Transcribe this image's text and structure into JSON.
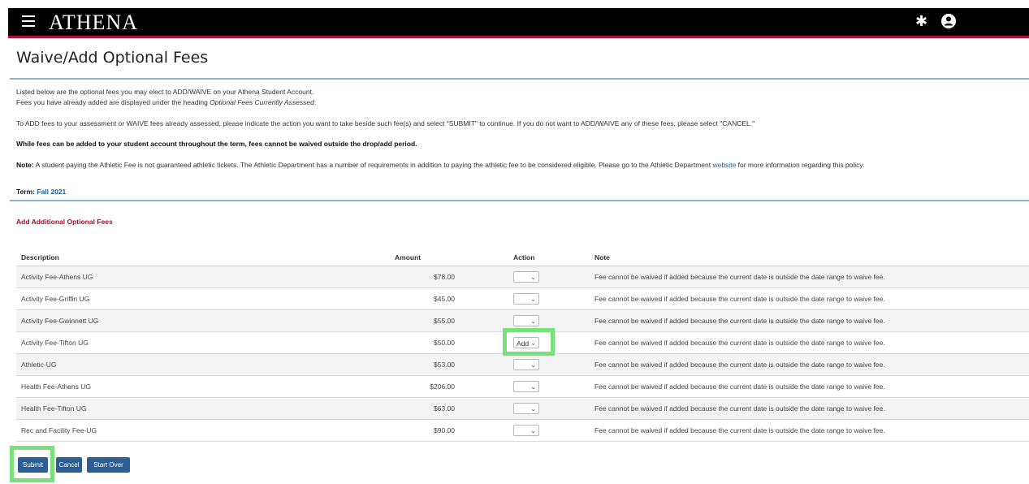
{
  "header": {
    "brand": "ATHENA",
    "icons": [
      "hamburger-menu-icon",
      "gear-icon",
      "user-icon"
    ],
    "bar_color": "#000000",
    "accent_color": "#ba0c2f"
  },
  "page": {
    "title": "Waive/Add Optional Fees"
  },
  "intro": {
    "line1": "Listed below are the optional fees you may elect to ADD/WAIVE on your Athena Student Account.",
    "line2_prefix": "Fees you have already added are displayed under the heading ",
    "line2_italic": "Optional Fees Currently Assessed",
    "line2_suffix": ".",
    "instructions": "To ADD fees to your assessment or WAIVE fees already assessed, please indicate the action you want to take beside such fee(s) and select \"SUBMIT\" to continue. If you do not want to ADD/WAIVE any of these fees, please select \"CANCEL.\"",
    "warning": "While fees can be added to your student account throughout the term, fees cannot be waived outside the drop/add period.",
    "note_label": "Note:",
    "note_text": " A student paying the Athletic Fee is not guaranteed athletic tickets. The Athletic Department has a number of requirements in addition to paying the athletic fee to be considered eligible. Please go to the Athletic Department ",
    "note_link": "website",
    "note_suffix": " for more information regarding this policy."
  },
  "term": {
    "label": "Term:",
    "value": "Fall 2021"
  },
  "section": {
    "title": "Add Additional Optional Fees"
  },
  "table": {
    "headers": {
      "description": "Description",
      "amount": "Amount",
      "action": "Action",
      "note": "Note"
    },
    "rows": [
      {
        "description": "Activity Fee-Athens UG",
        "amount": "$78.00",
        "action": "",
        "note": "Fee cannot be waived if added because the current date is outside the date range to waive fee."
      },
      {
        "description": "Activity Fee-Griffin UG",
        "amount": "$45.00",
        "action": "",
        "note": "Fee cannot be waived if added because the current date is outside the date range to waive fee."
      },
      {
        "description": "Activity Fee-Gwinnett UG",
        "amount": "$55.00",
        "action": "",
        "note": "Fee cannot be waived if added because the current date is outside the date range to waive fee."
      },
      {
        "description": "Activity Fee-Tifton UG",
        "amount": "$50.00",
        "action": "Add",
        "note": "Fee cannot be waived if added because the current date is outside the date range to waive fee."
      },
      {
        "description": "Athletic-UG",
        "amount": "$53.00",
        "action": "",
        "note": "Fee cannot be waived if added because the current date is outside the date range to waive fee."
      },
      {
        "description": "Health Fee-Athens UG",
        "amount": "$206.00",
        "action": "",
        "note": "Fee cannot be waived if added because the current date is outside the date range to waive fee."
      },
      {
        "description": "Health Fee-Tifton UG",
        "amount": "$63.00",
        "action": "",
        "note": "Fee cannot be waived if added because the current date is outside the date range to waive fee."
      },
      {
        "description": "Rec and Facility Fee-UG",
        "amount": "$90.00",
        "action": "",
        "note": "Fee cannot be waived if added because the current date is outside the date range to waive fee."
      }
    ]
  },
  "buttons": {
    "submit": "Submit",
    "cancel": "Cancel",
    "start_over": "Start Over"
  },
  "colors": {
    "button": "#2c5e93",
    "highlight": "#7ae07a",
    "section_title": "#a0102a",
    "link": "#1f5d9b"
  }
}
